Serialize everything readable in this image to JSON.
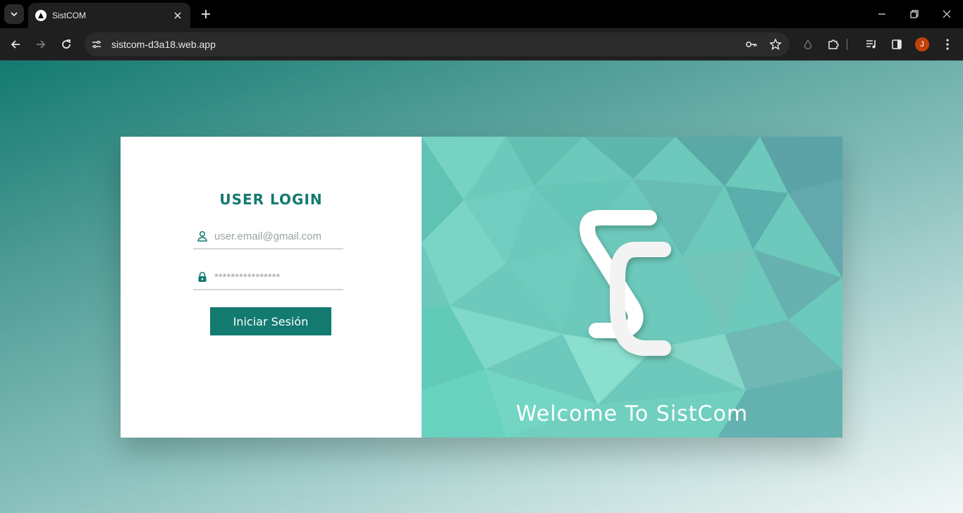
{
  "browser": {
    "tab_title": "SistCOM",
    "url": "sistcom-d3a18.web.app",
    "profile_initial": "J",
    "icons": [
      "tab-search-icon",
      "close-icon",
      "plus-icon",
      "minimize-icon",
      "restore-icon",
      "back-icon",
      "forward-icon",
      "reload-icon",
      "site-info-icon",
      "key-icon",
      "star-icon",
      "recycle-icon",
      "puzzle-icon",
      "media-icon",
      "sidepanel-icon",
      "more-icon"
    ]
  },
  "login": {
    "title": "USER LOGIN",
    "email_placeholder": "user.email@gmail.com",
    "password_placeholder": "****************",
    "submit_label": "Iniciar Sesión"
  },
  "brand": {
    "welcome_text": "Welcome To SistCom",
    "logo_name": "SC"
  },
  "colors": {
    "accent": "#137a70",
    "panel_teal": "#6fcdbf"
  }
}
